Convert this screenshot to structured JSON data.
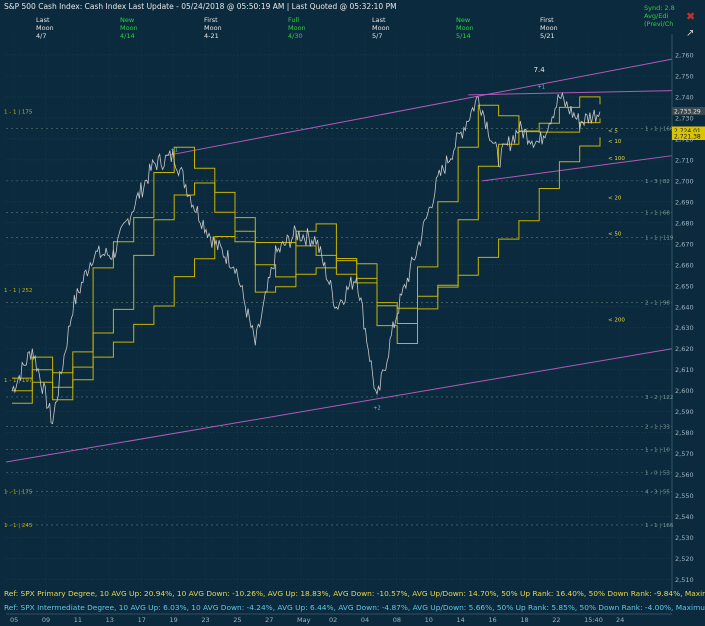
{
  "header": {
    "title": "S&P 500 Cash Index:  Cash Index  Last Update - 05/24/2018 @ 05:50:19 AM | Last Quoted @ 05:32:10 PM",
    "cycles": [
      {
        "phase": "Last",
        "body": "Moon",
        "date": "4/7",
        "color": "#e6e6e6"
      },
      {
        "phase": "New",
        "body": "Moon",
        "date": "4/14",
        "color": "#2bd43b"
      },
      {
        "phase": "First",
        "body": "Moon",
        "date": "4-21",
        "color": "#e6e6e6"
      },
      {
        "phase": "Full",
        "body": "Moon",
        "date": "4/30",
        "color": "#2bd43b"
      },
      {
        "phase": "Last",
        "body": "Moon",
        "date": "5/7",
        "color": "#e6e6e6"
      },
      {
        "phase": "New",
        "body": "Moon",
        "date": "5/14",
        "color": "#2bd43b"
      },
      {
        "phase": "First",
        "body": "Moon",
        "date": "5/21",
        "color": "#e6e6e6"
      }
    ],
    "right_tags": [
      "Synd: 2.8",
      "Avg/Edi",
      "(Previ/Ch"
    ]
  },
  "footer": {
    "primary": "Ref: SPX Primary Degree, 10 AVG Up: 20.94%, 10 AVG Down: -10.26%, AVG Up: 18.83%, AVG Down: -10.57%, AVG Up/Down: 14.70%, 50%  Up Rank: 16.40%, 50% Down Rank: -9.84%, Maximum Up: 58.71%, Maximum",
    "intermediate": "Ref: SPX Intermediate Degree, 10 AVG Up: 6.03%, 10 AVG Down: -4.24%, AVG Up: 6.44%, AVG Down: -4.87%, AVG Up/Down: 5.66%, 50%  Up Rank: 5.85%, 50% Down Rank: -4.00%, Maximum Up: 20.27%, Maximum Do"
  },
  "colors": {
    "background": "#0b2a3d",
    "price": "#c8c8c8",
    "bands": "#c8b400",
    "channel": "#b25ab8",
    "labels": "#c8b400",
    "fib": "#5a7a7a",
    "primary_footer": "#e8d84a",
    "intermediate_footer": "#5fc8e8"
  },
  "chart_data": {
    "type": "line",
    "title": "S&P 500 Cash Index",
    "ylim": [
      2505,
      2770
    ],
    "y_ticks": [
      2510,
      2520,
      2530,
      2540,
      2550,
      2560,
      2570,
      2580,
      2590,
      2600,
      2610,
      2620,
      2630,
      2640,
      2650,
      2660,
      2670,
      2680,
      2690,
      2700,
      2710,
      2720,
      2730,
      2740,
      2750,
      2760
    ],
    "x_ticks": [
      "05",
      "09",
      "11",
      "13",
      "17",
      "19",
      "23",
      "25",
      "27",
      "May",
      "02",
      "04",
      "08",
      "10",
      "14",
      "16",
      "18",
      "22",
      "15:40",
      "24"
    ],
    "last_price_labels": [
      "2,733.29",
      "2,724.01",
      "2,721.38"
    ],
    "price_series": [
      {
        "d": 0,
        "v": 2600
      },
      {
        "d": 1,
        "v": 2620
      },
      {
        "d": 2,
        "v": 2585
      },
      {
        "d": 3,
        "v": 2640
      },
      {
        "d": 4,
        "v": 2665
      },
      {
        "d": 5,
        "v": 2665
      },
      {
        "d": 6,
        "v": 2688
      },
      {
        "d": 7,
        "v": 2708
      },
      {
        "d": 8,
        "v": 2712
      },
      {
        "d": 9,
        "v": 2688
      },
      {
        "d": 10,
        "v": 2670
      },
      {
        "d": 11,
        "v": 2660
      },
      {
        "d": 12,
        "v": 2622
      },
      {
        "d": 13,
        "v": 2665
      },
      {
        "d": 14,
        "v": 2675
      },
      {
        "d": 15,
        "v": 2672
      },
      {
        "d": 16,
        "v": 2640
      },
      {
        "d": 17,
        "v": 2655
      },
      {
        "d": 18,
        "v": 2595
      },
      {
        "d": 19,
        "v": 2638
      },
      {
        "d": 20,
        "v": 2668
      },
      {
        "d": 21,
        "v": 2700
      },
      {
        "d": 22,
        "v": 2720
      },
      {
        "d": 23,
        "v": 2740
      },
      {
        "d": 24,
        "v": 2710
      },
      {
        "d": 25,
        "v": 2725
      },
      {
        "d": 26,
        "v": 2718
      },
      {
        "d": 27,
        "v": 2740
      },
      {
        "d": 28,
        "v": 2728
      },
      {
        "d": 29,
        "v": 2733
      }
    ],
    "cycle_labels": [
      {
        "text": "7.4",
        "d": 26.0,
        "v": 2752,
        "color": "#e6e6e6"
      },
      {
        "text": "+1",
        "d": 8.0,
        "v": 2714,
        "color": "#5fc8e8"
      },
      {
        "text": "+2",
        "d": 18.0,
        "v": 2591,
        "color": "#5fc8e8"
      },
      {
        "text": "+1",
        "d": 26.1,
        "v": 2744,
        "color": "#5fc8e8"
      }
    ],
    "left_levels": [
      {
        "text": "1 - 1 | 175",
        "v": 2733
      },
      {
        "text": "1 - 1 | 252",
        "v": 2648
      },
      {
        "text": "1 - 1 | 197",
        "v": 2605
      },
      {
        "text": "1 - 1 | 175",
        "v": 2552
      },
      {
        "text": "1 - 1 | 245",
        "v": 2536
      }
    ],
    "right_levels": [
      {
        "text": "1 - 1 | 166",
        "v": 2725
      },
      {
        "text": "1 - 3 | 82",
        "v": 2700
      },
      {
        "text": "1 - 1 | 68",
        "v": 2685
      },
      {
        "text": "1 - 1 | 119",
        "v": 2673
      },
      {
        "text": "2 - 1 | 98",
        "v": 2642
      },
      {
        "text": "3 - 2 | 122",
        "v": 2597
      },
      {
        "text": "2 - 1 | 33",
        "v": 2583
      },
      {
        "text": "1 - 1 | 10",
        "v": 2572
      },
      {
        "text": "1 - 0 | 53",
        "v": 2561
      },
      {
        "text": "4 - 3 | 55",
        "v": 2552
      },
      {
        "text": "1 - 1 | 166",
        "v": 2536
      }
    ],
    "ma_labels": [
      {
        "text": "< 5",
        "v": 2724
      },
      {
        "text": "< 10",
        "v": 2719
      },
      {
        "text": "< 100",
        "v": 2711
      },
      {
        "text": "< 20",
        "v": 2692
      },
      {
        "text": "< 50",
        "v": 2675
      },
      {
        "text": "< 200",
        "v": 2634
      }
    ]
  }
}
